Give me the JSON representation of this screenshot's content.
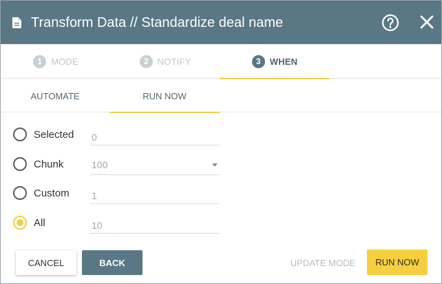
{
  "header": {
    "title": "Transform Data // Standardize deal name"
  },
  "steps": [
    {
      "number": "1",
      "label": "MODE",
      "active": false
    },
    {
      "number": "2",
      "label": "NOTIFY",
      "active": false
    },
    {
      "number": "3",
      "label": "WHEN",
      "active": true
    }
  ],
  "subtabs": [
    {
      "label": "AUTOMATE",
      "active": false
    },
    {
      "label": "RUN NOW",
      "active": true
    }
  ],
  "options": [
    {
      "label": "Selected",
      "value": "0",
      "checked": false
    },
    {
      "label": "Chunk",
      "value": "100",
      "checked": false
    },
    {
      "label": "Custom",
      "value": "1",
      "checked": false
    },
    {
      "label": "All",
      "value": "10",
      "checked": true
    }
  ],
  "buttons": {
    "cancel": "CANCEL",
    "back": "BACK",
    "update_mode": "UPDATE MODE",
    "run_now": "RUN NOW"
  },
  "colors": {
    "header_bg": "#5a7785",
    "accent": "#f3ce45",
    "run_button": "#f5cf3d"
  },
  "icons": {
    "header": "document-icon",
    "help": "help-circle-icon",
    "close": "close-icon",
    "select_caret": "caret-down-icon"
  }
}
